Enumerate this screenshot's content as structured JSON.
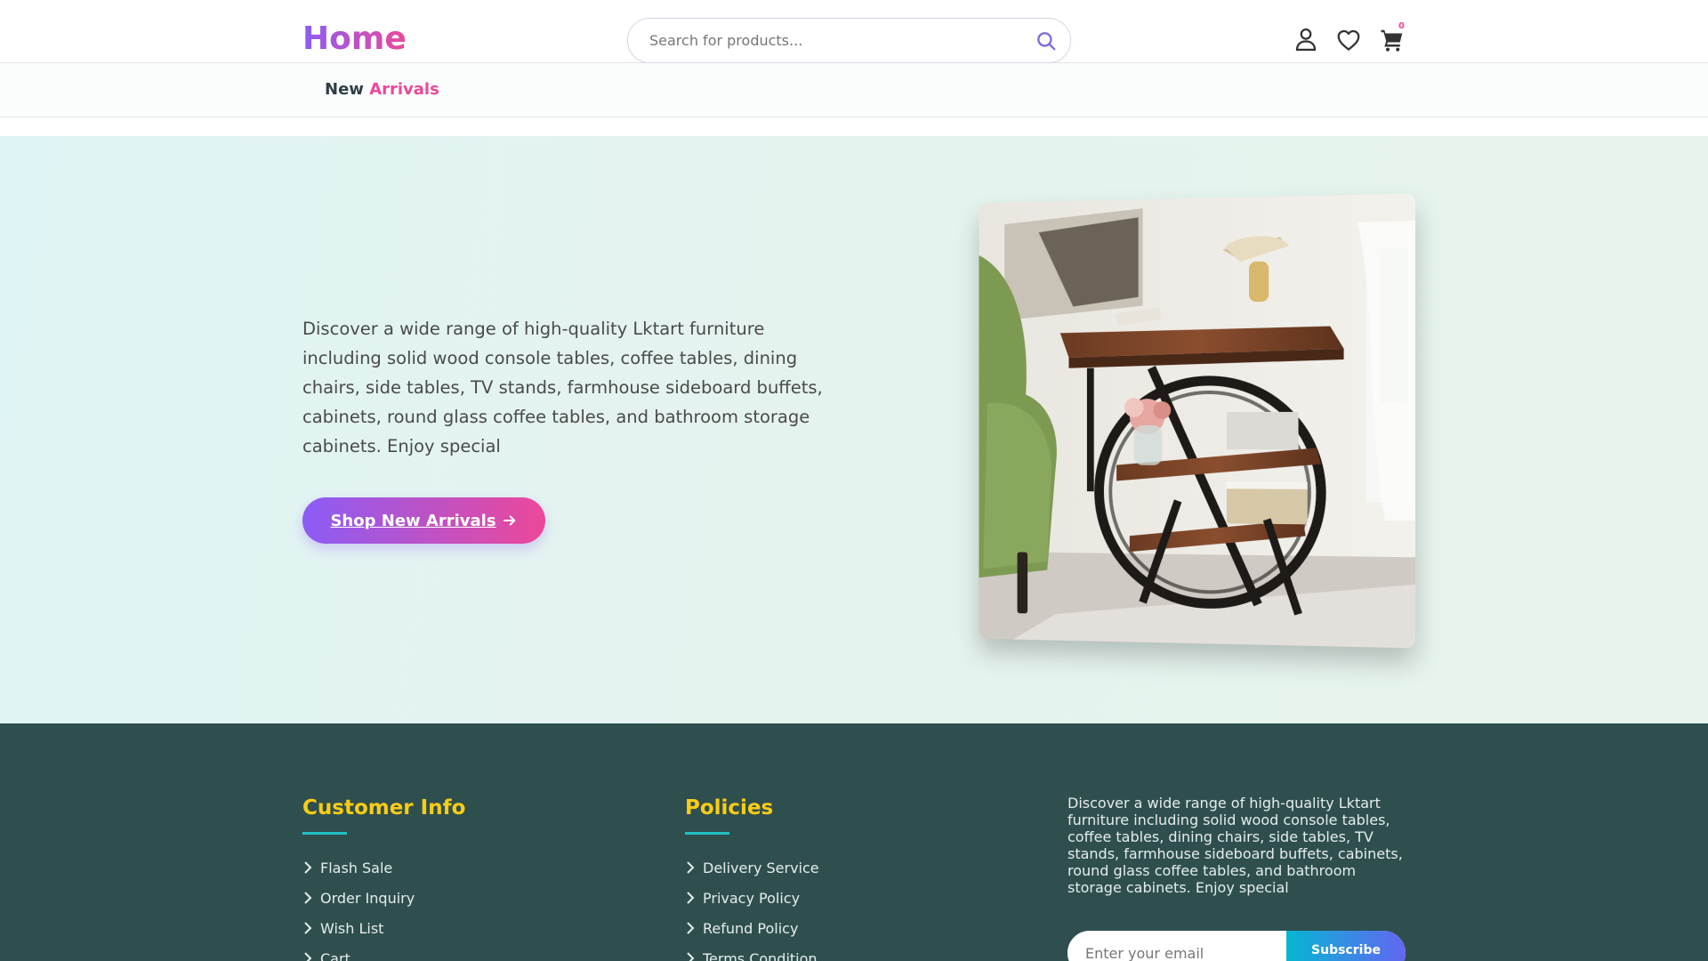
{
  "header": {
    "logo": "Home",
    "search_placeholder": "Search for products...",
    "cart_count": "0"
  },
  "nav": {
    "item_word1": "New",
    "item_word2": "Arrivals"
  },
  "hero": {
    "description": "Discover a wide range of high-quality Lktart furniture including solid wood console tables, coffee tables, dining chairs, side tables, TV stands, farmhouse sideboard buffets, cabinets, round glass coffee tables, and bathroom storage cabinets. Enjoy special",
    "button_label": "Shop New Arrivals"
  },
  "footer": {
    "customer_info": {
      "title": "Customer Info",
      "links": [
        "Flash Sale",
        "Order Inquiry",
        "Wish List",
        "Cart"
      ]
    },
    "policies": {
      "title": "Policies",
      "links": [
        "Delivery Service",
        "Privacy Policy",
        "Refund Policy",
        "Terms Condition"
      ]
    },
    "about": "Discover a wide range of high-quality Lktart furniture including solid wood console tables, coffee tables, dining chairs, side tables, TV stands, farmhouse sideboard buffets, cabinets, round glass coffee tables, and bathroom storage cabinets. Enjoy special",
    "email_placeholder": "Enter your email",
    "subscribe_label": "Subscribe"
  },
  "icons": {
    "search": "search-icon",
    "account": "user-icon",
    "wishlist": "heart-icon",
    "cart": "cart-icon",
    "link_bullet": "chevron-right-icon",
    "button_arrow": "arrow-right-icon"
  },
  "colors": {
    "brand_gradient_start": "#8b5cf6",
    "brand_gradient_end": "#ec4899",
    "footer_bg": "#2f4f4f",
    "footer_heading": "#facc15",
    "footer_accent": "#22c1c3"
  }
}
